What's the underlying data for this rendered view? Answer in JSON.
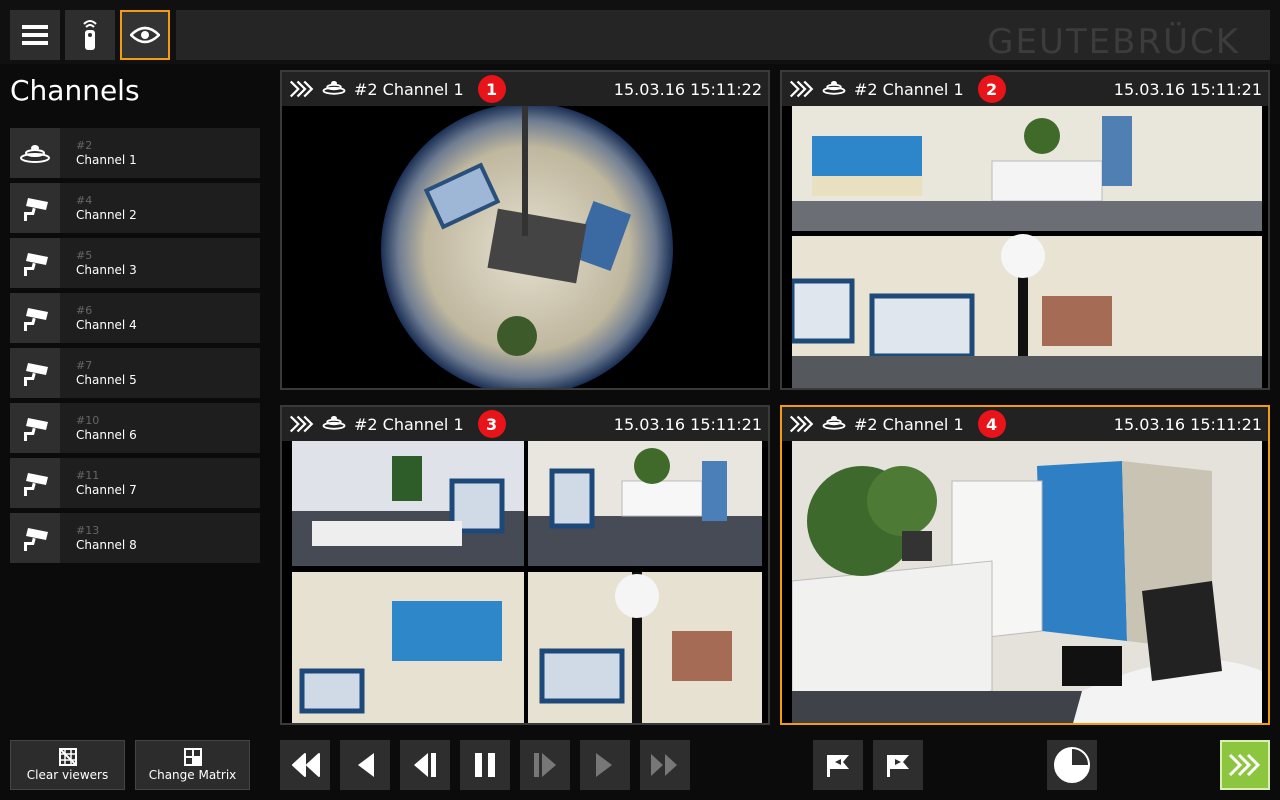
{
  "topbar": {
    "menu_icon": "menu-icon",
    "remote_icon": "remote-icon",
    "view_icon": "eye-icon",
    "brand": "GEUTEBRÜCK",
    "accent_color": "#f39c12"
  },
  "sidebar": {
    "title": "Channels",
    "channels": [
      {
        "num": "#2",
        "name": "Channel 1",
        "icon": "fisheye-camera-icon"
      },
      {
        "num": "#4",
        "name": "Channel 2",
        "icon": "cctv-camera-icon"
      },
      {
        "num": "#5",
        "name": "Channel 3",
        "icon": "cctv-camera-icon"
      },
      {
        "num": "#6",
        "name": "Channel 4",
        "icon": "cctv-camera-icon"
      },
      {
        "num": "#7",
        "name": "Channel 5",
        "icon": "cctv-camera-icon"
      },
      {
        "num": "#10",
        "name": "Channel 6",
        "icon": "cctv-camera-icon"
      },
      {
        "num": "#11",
        "name": "Channel 7",
        "icon": "cctv-camera-icon"
      },
      {
        "num": "#13",
        "name": "Channel 8",
        "icon": "cctv-camera-icon"
      }
    ]
  },
  "viewers": [
    {
      "title": "#2 Channel 1",
      "number": "1",
      "timestamp": "15.03.16 15:11:22",
      "mode": "fisheye"
    },
    {
      "title": "#2 Channel 1",
      "number": "2",
      "timestamp": "15.03.16 15:11:21",
      "mode": "panorama"
    },
    {
      "title": "#2 Channel 1",
      "number": "3",
      "timestamp": "15.03.16 15:11:21",
      "mode": "quad"
    },
    {
      "title": "#2 Channel 1",
      "number": "4",
      "timestamp": "15.03.16 15:11:21",
      "mode": "single",
      "selected": true
    }
  ],
  "bottom": {
    "clear_viewers": "Clear viewers",
    "change_matrix": "Change Matrix"
  },
  "playback": {
    "buttons": [
      "fast-rewind-icon",
      "play-backward-icon",
      "step-backward-icon",
      "pause-icon",
      "step-forward-icon",
      "play-forward-icon",
      "fast-forward-icon"
    ],
    "live_color": "#8cc63f"
  }
}
